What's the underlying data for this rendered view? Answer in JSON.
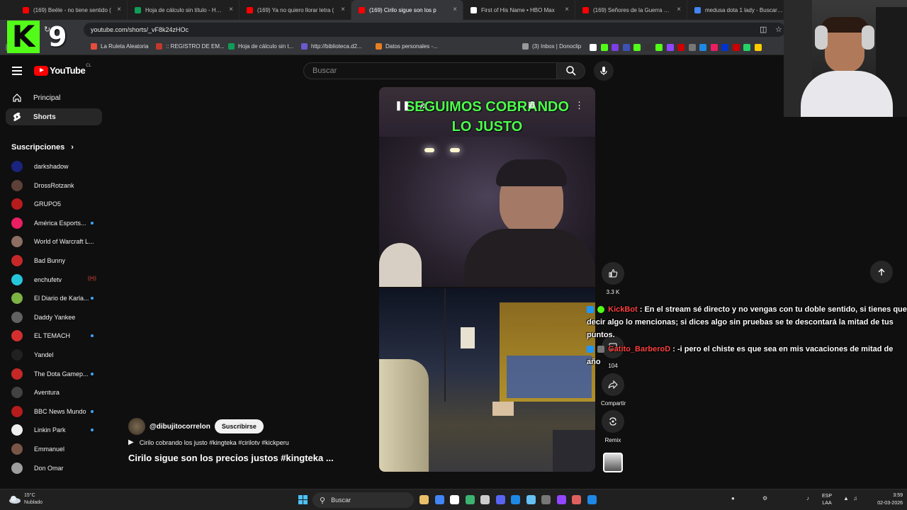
{
  "browser": {
    "tabs": [
      {
        "title": "(169) Beéle - no tiene sentido (",
        "fav": "#ff0000",
        "active": false
      },
      {
        "title": "Hoja de cálculo sin título - Hoja",
        "fav": "#0f9d58",
        "active": false
      },
      {
        "title": "(169) Ya no quiero llorar letra (",
        "fav": "#ff0000",
        "active": false
      },
      {
        "title": "(169) Cirilo sigue son los p",
        "fav": "#ff0000",
        "active": true
      },
      {
        "title": "First of His Name • HBO Max",
        "fav": "#ffffff",
        "active": false
      },
      {
        "title": "(169) Señores de la Guerra — F",
        "fav": "#ff0000",
        "active": false
      },
      {
        "title": "medusa dota 1 lady - Buscar co",
        "fav": "#4285f4",
        "active": false
      }
    ],
    "url": "youtube.com/shorts/_vF8k24zHOc",
    "bookmarks": [
      {
        "label": "La Ruleta Aleatoria",
        "color": "#e74c3c"
      },
      {
        "label": ":: REGISTRO DE EM...",
        "color": "#c0392b"
      },
      {
        "label": "Hoja de cálculo sin t...",
        "color": "#0f9d58"
      },
      {
        "label": "http://biblioteca.d2...",
        "color": "#6a5acd"
      },
      {
        "label": "Datos personales -...",
        "color": "#e67e22"
      },
      {
        "label": "(3) Inbox | Donoclip",
        "color": "#999999"
      }
    ]
  },
  "youtube": {
    "logo_text": "YouTube",
    "logo_country": "CL",
    "search_placeholder": "Buscar",
    "nav": [
      {
        "label": "Principal",
        "icon": "home-icon"
      },
      {
        "label": "Shorts",
        "icon": "shorts-icon"
      }
    ],
    "subscriptions_title": "Suscripciones",
    "subscriptions": [
      {
        "name": "darkshadow",
        "color": "#1a237e",
        "mark": ""
      },
      {
        "name": "DrossRotzank",
        "color": "#5d4037",
        "mark": ""
      },
      {
        "name": "GRUPO5",
        "color": "#b71c1c",
        "mark": ""
      },
      {
        "name": "América Esports...",
        "color": "#e91e63",
        "mark": "dot"
      },
      {
        "name": "World of Warcraft L...",
        "color": "#8d6e63",
        "mark": ""
      },
      {
        "name": "Bad Bunny",
        "color": "#c62828",
        "mark": ""
      },
      {
        "name": "enchufetv",
        "color": "#26c6da",
        "mark": "live"
      },
      {
        "name": "El Diario de Karla...",
        "color": "#7cb342",
        "mark": "dot"
      },
      {
        "name": "Daddy Yankee",
        "color": "#616161",
        "mark": ""
      },
      {
        "name": "EL TEMACH",
        "color": "#d32f2f",
        "mark": "dot"
      },
      {
        "name": "Yandel",
        "color": "#212121",
        "mark": ""
      },
      {
        "name": "The Dota Gamep...",
        "color": "#c62828",
        "mark": "dot"
      },
      {
        "name": "Aventura",
        "color": "#424242",
        "mark": ""
      },
      {
        "name": "BBC News Mundo",
        "color": "#b71c1c",
        "mark": "dot"
      },
      {
        "name": "Linkin Park",
        "color": "#eeeeee",
        "mark": "dot"
      },
      {
        "name": "Emmanuel",
        "color": "#795548",
        "mark": ""
      },
      {
        "name": "Don Omar",
        "color": "#9e9e9e",
        "mark": ""
      }
    ],
    "video": {
      "caption_line1": "SEGUIMOS COBRANDO",
      "caption_line2": "LO JUSTO",
      "channel": "@dibujitocorrelon",
      "subscribe": "Suscribirse",
      "sound": "Cirilo cobrando los justo #kingteka #cirilotv #kickperu",
      "title": "Cirilo sigue son los precios justos #kingteka ..."
    },
    "actions": {
      "likes": "3.3 K",
      "comments": "104",
      "share": "Compartir",
      "remix": "Remix"
    }
  },
  "overlay": {
    "kick_number": "9",
    "chat": [
      {
        "user": "KickBot",
        "text": "En el stream sé directo y no vengas con tu doble sentido, si tienes que decir algo lo mencionas; si dices algo sin pruebas se te descontará la mitad de tus puntos."
      },
      {
        "user": "Gatito_BarberoD",
        "text": "-i pero el chiste es que sea en mis vacaciones de mitad de año"
      }
    ]
  },
  "taskbar": {
    "weather_temp": "15°C",
    "weather_desc": "Nublado",
    "search": "Buscar",
    "lang1": "ESP",
    "lang2": "LAA",
    "time": "3:59",
    "date": "02-03-2026"
  }
}
